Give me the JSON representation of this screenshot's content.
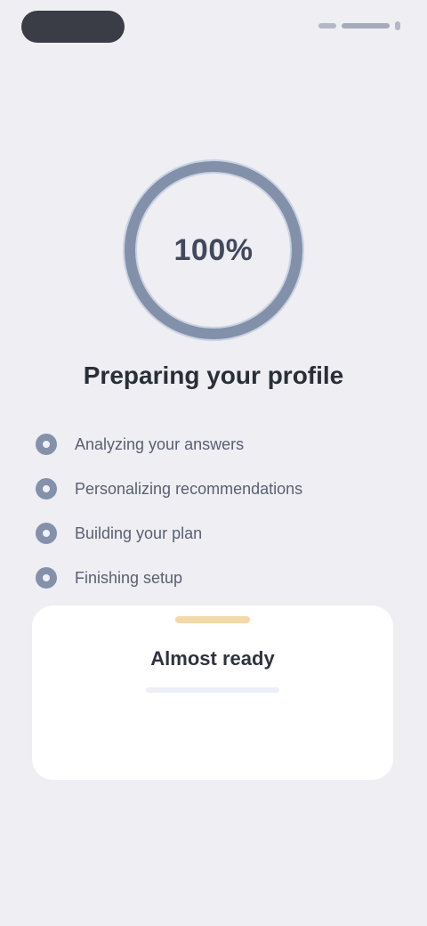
{
  "status": {
    "pill": "",
    "right": ""
  },
  "progress": {
    "percent_text": "100%",
    "value": 100
  },
  "main": {
    "title": "Preparing your profile",
    "steps": [
      {
        "label": "Analyzing your answers"
      },
      {
        "label": "Personalizing recommendations"
      },
      {
        "label": "Building your plan"
      },
      {
        "label": "Finishing setup"
      }
    ]
  },
  "card": {
    "badge": "",
    "title": "Almost ready",
    "text": "",
    "footer": ""
  },
  "colors": {
    "background": "#eeeef3",
    "ring_track": "#c9d2e2",
    "ring_progress": "#8390aa",
    "step_icon": "#8591ab",
    "card": "#ffffff",
    "accent": "#f3d9a8"
  }
}
